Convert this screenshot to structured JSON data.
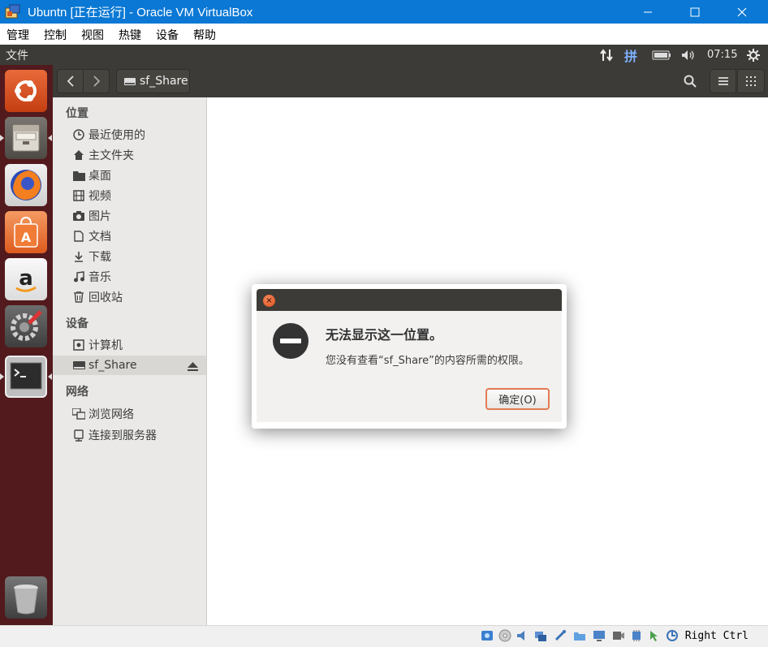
{
  "window": {
    "title": "Ubuntn [正在运行] - Oracle VM VirtualBox",
    "minimize_icon": "minimize-icon",
    "maximize_icon": "maximize-icon",
    "close_icon": "close-icon"
  },
  "vbox_menu": [
    "管理",
    "控制",
    "视图",
    "热键",
    "设备",
    "帮助"
  ],
  "topbar": {
    "app_name": "文件",
    "input_method": "拼",
    "time": "07:15"
  },
  "launcher": [
    "ubuntu-logo",
    "files",
    "firefox",
    "software-center",
    "amazon",
    "system-settings",
    "terminal",
    "trash"
  ],
  "nautilus": {
    "location": "sf_Share"
  },
  "sidebar": {
    "places_header": "位置",
    "places": [
      {
        "label": "最近使用的",
        "icon": "recent-icon"
      },
      {
        "label": "主文件夹",
        "icon": "home-icon"
      },
      {
        "label": "桌面",
        "icon": "desktop-folder-icon"
      },
      {
        "label": "视频",
        "icon": "video-icon"
      },
      {
        "label": "图片",
        "icon": "camera-icon"
      },
      {
        "label": "文档",
        "icon": "document-icon"
      },
      {
        "label": "下载",
        "icon": "download-icon"
      },
      {
        "label": "音乐",
        "icon": "music-icon"
      },
      {
        "label": "回收站",
        "icon": "trash-icon"
      }
    ],
    "devices_header": "设备",
    "devices": [
      {
        "label": "计算机",
        "icon": "computer-icon"
      },
      {
        "label": "sf_Share",
        "icon": "drive-icon",
        "selected": true
      }
    ],
    "network_header": "网络",
    "network": [
      {
        "label": "浏览网络",
        "icon": "network-icon"
      },
      {
        "label": "连接到服务器",
        "icon": "server-icon"
      }
    ]
  },
  "dialog": {
    "heading": "无法显示这一位置。",
    "message": "您没有查看“sf_Share”的内容所需的权限。",
    "ok_label": "确定(O)"
  },
  "statusbar": {
    "host_key": "Right Ctrl"
  },
  "colors": {
    "titlebar": "#0a78d4",
    "unity_panel": "#3c3b37",
    "launcher": "#521a1d",
    "accent_orange": "#e27b52"
  }
}
